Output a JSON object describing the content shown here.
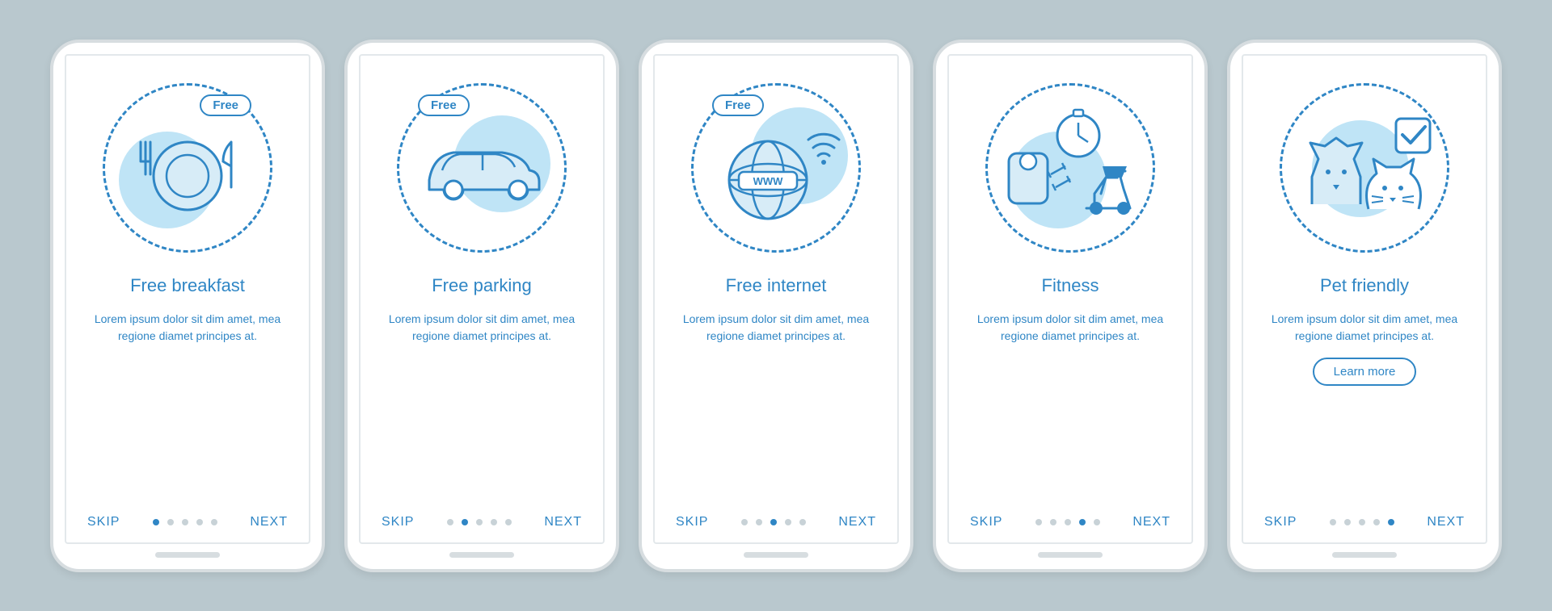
{
  "common": {
    "skip": "SKIP",
    "next": "NEXT",
    "free_badge": "Free",
    "www": "WWW",
    "learn_more": "Learn more",
    "description": "Lorem ipsum dolor sit dim amet, mea regione diamet principes at.",
    "total_pages": 5,
    "colors": {
      "primary": "#2f86c5",
      "accent_fill": "#bfe4f6",
      "background": "#b9c8ce"
    }
  },
  "screens": [
    {
      "id": "breakfast",
      "title": "Free breakfast",
      "icon": "plate-fork-knife-icon",
      "has_free_badge": true,
      "has_learn_more": false,
      "active_index": 0
    },
    {
      "id": "parking",
      "title": "Free parking",
      "icon": "car-icon",
      "has_free_badge": true,
      "has_learn_more": false,
      "active_index": 1
    },
    {
      "id": "internet",
      "title": "Free internet",
      "icon": "globe-wifi-icon",
      "has_free_badge": true,
      "has_learn_more": false,
      "active_index": 2
    },
    {
      "id": "fitness",
      "title": "Fitness",
      "icon": "gym-equipment-icon",
      "has_free_badge": false,
      "has_learn_more": false,
      "active_index": 3
    },
    {
      "id": "pet",
      "title": "Pet friendly",
      "icon": "pets-checkbox-icon",
      "has_free_badge": false,
      "has_learn_more": true,
      "active_index": 4
    }
  ]
}
